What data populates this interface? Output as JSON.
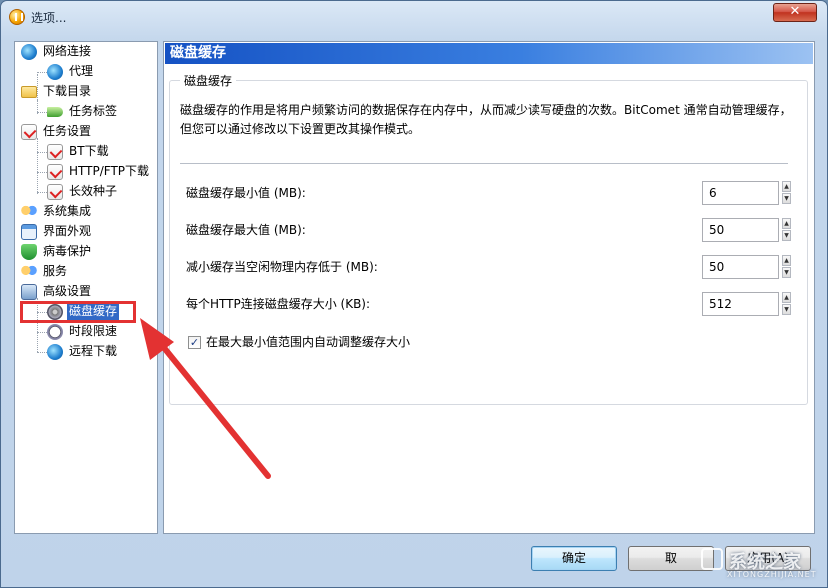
{
  "window": {
    "title": "选项..."
  },
  "tree": {
    "items": [
      {
        "label": "网络连接",
        "icon": "globe-icon"
      },
      {
        "label": "代理",
        "icon": "proxy-globe-icon"
      },
      {
        "label": "下载目录",
        "icon": "folder-icon"
      },
      {
        "label": "任务标签",
        "icon": "tag-icon"
      },
      {
        "label": "任务设置",
        "icon": "task-icon"
      },
      {
        "label": "BT下载",
        "icon": "task-icon"
      },
      {
        "label": "HTTP/FTP下载",
        "icon": "task-icon"
      },
      {
        "label": "长效种子",
        "icon": "task-icon"
      },
      {
        "label": "系统集成",
        "icon": "people-icon"
      },
      {
        "label": "界面外观",
        "icon": "window-icon"
      },
      {
        "label": "病毒保护",
        "icon": "shield-icon"
      },
      {
        "label": "服务",
        "icon": "people-icon"
      },
      {
        "label": "高级设置",
        "icon": "advanced-icon"
      },
      {
        "label": "磁盘缓存",
        "icon": "disk-icon",
        "selected": true
      },
      {
        "label": "时段限速",
        "icon": "clock-icon"
      },
      {
        "label": "远程下载",
        "icon": "globe-icon"
      }
    ]
  },
  "panel": {
    "header": "磁盘缓存",
    "group_label": "磁盘缓存",
    "description": "磁盘缓存的作用是将用户频繁访问的数据保存在内存中，从而减少读写硬盘的次数。BitComet 通常自动管理缓存，但您可以通过修改以下设置更改其操作模式。",
    "fields": [
      {
        "label": "磁盘缓存最小值 (MB):",
        "value": "6"
      },
      {
        "label": "磁盘缓存最大值 (MB):",
        "value": "50"
      },
      {
        "label": "减小缓存当空闲物理内存低于 (MB):",
        "value": "50"
      },
      {
        "label": "每个HTTP连接磁盘缓存大小 (KB):",
        "value": "512"
      }
    ],
    "checkbox": {
      "label": "在最大最小值范围内自动调整缓存大小",
      "checked": true
    }
  },
  "buttons": {
    "ok": "确定",
    "cancel": "取",
    "apply": "应用(A)"
  },
  "watermark": {
    "text": "系统之家",
    "sub": "XITONGZHIJIA.NET"
  },
  "colors": {
    "selection": "#3169c6",
    "header_bar": "#1552c4",
    "highlight": "#e33232"
  }
}
